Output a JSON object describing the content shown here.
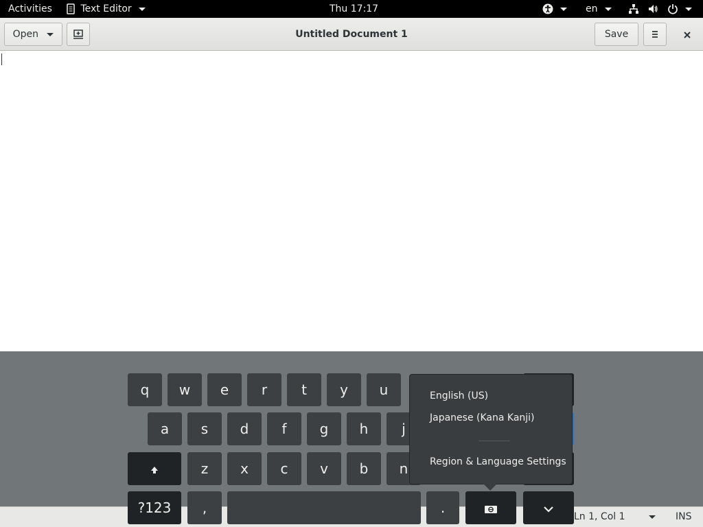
{
  "topbar": {
    "activities": "Activities",
    "app_menu": "Text Editor",
    "clock": "Thu 17:17",
    "language": "en"
  },
  "headerbar": {
    "open_label": "Open",
    "title": "Untitled Document 1",
    "save_label": "Save"
  },
  "statusbar": {
    "position": "Ln 1, Col 1",
    "mode": "INS"
  },
  "keyboard": {
    "row1": [
      "q",
      "w",
      "e",
      "r",
      "t",
      "y",
      "u"
    ],
    "row2": [
      "a",
      "s",
      "d",
      "f",
      "g",
      "h",
      "j"
    ],
    "row3": [
      "z",
      "x",
      "c",
      "v",
      "b",
      "n"
    ],
    "numbers_key": "?123",
    "comma": ",",
    "period": "."
  },
  "language_popover": {
    "items": [
      "English (US)",
      "Japanese (Kana Kanji)"
    ],
    "settings": "Region & Language Settings"
  }
}
